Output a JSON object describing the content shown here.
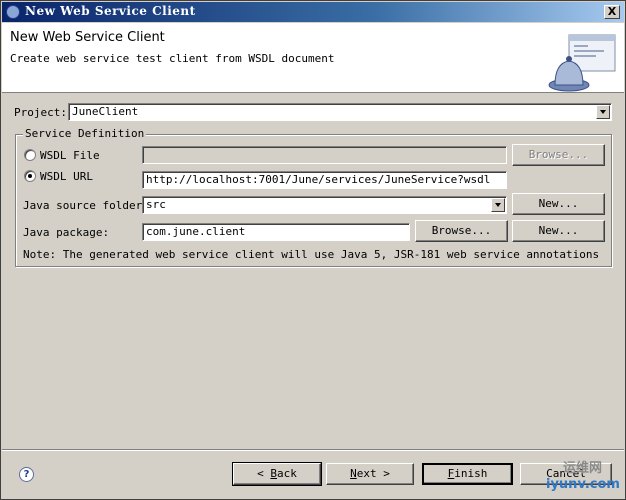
{
  "window": {
    "title": "New Web Service Client",
    "close_label": "X"
  },
  "header": {
    "title": "New Web Service Client",
    "subtitle": "Create web service test client from WSDL document",
    "icon": "web-service-wizard-banner-icon"
  },
  "project": {
    "label": "Project:",
    "value": "JuneClient"
  },
  "service_definition": {
    "legend": "Service Definition",
    "wsdl_file": {
      "label": "WSDL File",
      "selected": false,
      "value": "",
      "browse_label": "Browse..."
    },
    "wsdl_url": {
      "label": "WSDL URL",
      "selected": true,
      "value": "http://localhost:7001/June/services/JuneService?wsdl"
    },
    "java_source_folder": {
      "label": "Java source folder:",
      "value": "src",
      "new_label": "New..."
    },
    "java_package": {
      "label": "Java package:",
      "value": "com.june.client",
      "browse_label": "Browse...",
      "new_label": "New..."
    },
    "note": "Note: The generated web service client will use Java 5, JSR-181 web service annotations"
  },
  "footer": {
    "help_label": "?",
    "back_mnemonic": "B",
    "back_rest": "ack",
    "back_prefix": "< ",
    "next_mnemonic": "N",
    "next_rest": "ext",
    "next_suffix": " >",
    "finish_mnemonic": "F",
    "finish_rest": "inish",
    "cancel_label": "Cancel"
  },
  "watermark": {
    "line1": "运维网",
    "line2": "iyunv.com"
  }
}
